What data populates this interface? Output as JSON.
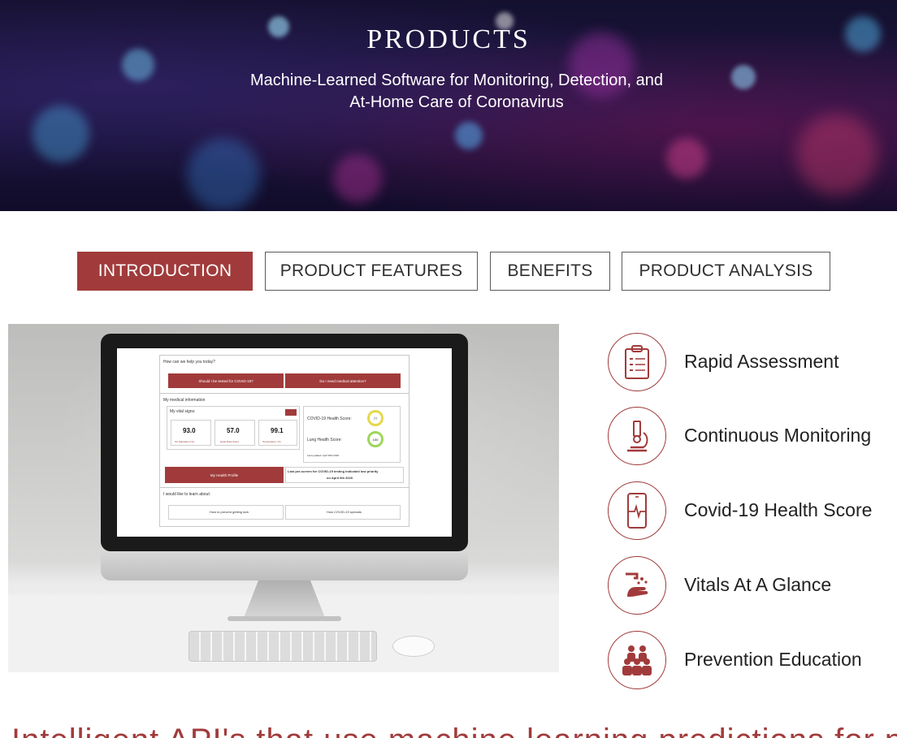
{
  "hero": {
    "title": "PRODUCTS",
    "subtitle_line1": "Machine-Learned Software for Monitoring, Detection, and",
    "subtitle_line2": "At-Home Care of Coronavirus"
  },
  "tabs": [
    {
      "label": "INTRODUCTION",
      "active": true
    },
    {
      "label": "PRODUCT FEATURES",
      "active": false
    },
    {
      "label": "BENEFITS",
      "active": false
    },
    {
      "label": "PRODUCT ANALYSIS",
      "active": false
    }
  ],
  "screen_app": {
    "help_title": "How can we help you today?",
    "btn_tested": "Should I be tested for COVID-19?",
    "btn_attention": "Do I need medical attention?",
    "medical_info": "My medical information",
    "vital_signs": "My vital signs:",
    "vitals": [
      {
        "value": "93.0",
        "label": "O2 Saturation (%)"
      },
      {
        "value": "57.0",
        "label": "Heart Rate (bpm)"
      },
      {
        "value": "99.1",
        "label": "Temperature (°F)"
      }
    ],
    "covid_score_label": "COVID-19 Health Score:",
    "covid_score": "77",
    "lung_score_label": "Lung Health Score:",
    "lung_score": "100",
    "last_updated": "Last updated: April 28th 2020",
    "btn_profile": "My Health Profile",
    "prescreen_line1": "Last pre-screen for COVID-19 testing indicated low priority",
    "prescreen_line2": "on April 6th 2020",
    "learn_title": "I would like to learn about:",
    "learn_prevent": "How to prevent getting sick",
    "learn_spread": "How COVID-19 spreads"
  },
  "features": [
    {
      "label": "Rapid Assessment",
      "icon": "clipboard-icon"
    },
    {
      "label": "Continuous Monitoring",
      "icon": "microscope-icon"
    },
    {
      "label": "Covid-19 Health Score",
      "icon": "phone-heartbeat-icon"
    },
    {
      "label": "Vitals At A Glance",
      "icon": "hand-wash-icon"
    },
    {
      "label": "Prevention Education",
      "icon": "people-group-icon"
    }
  ],
  "bottom_text": "Intelligent API's that use machine learning predictions for personalized",
  "colors": {
    "accent": "#a13b3b",
    "tab_border": "#5a5a5a"
  }
}
